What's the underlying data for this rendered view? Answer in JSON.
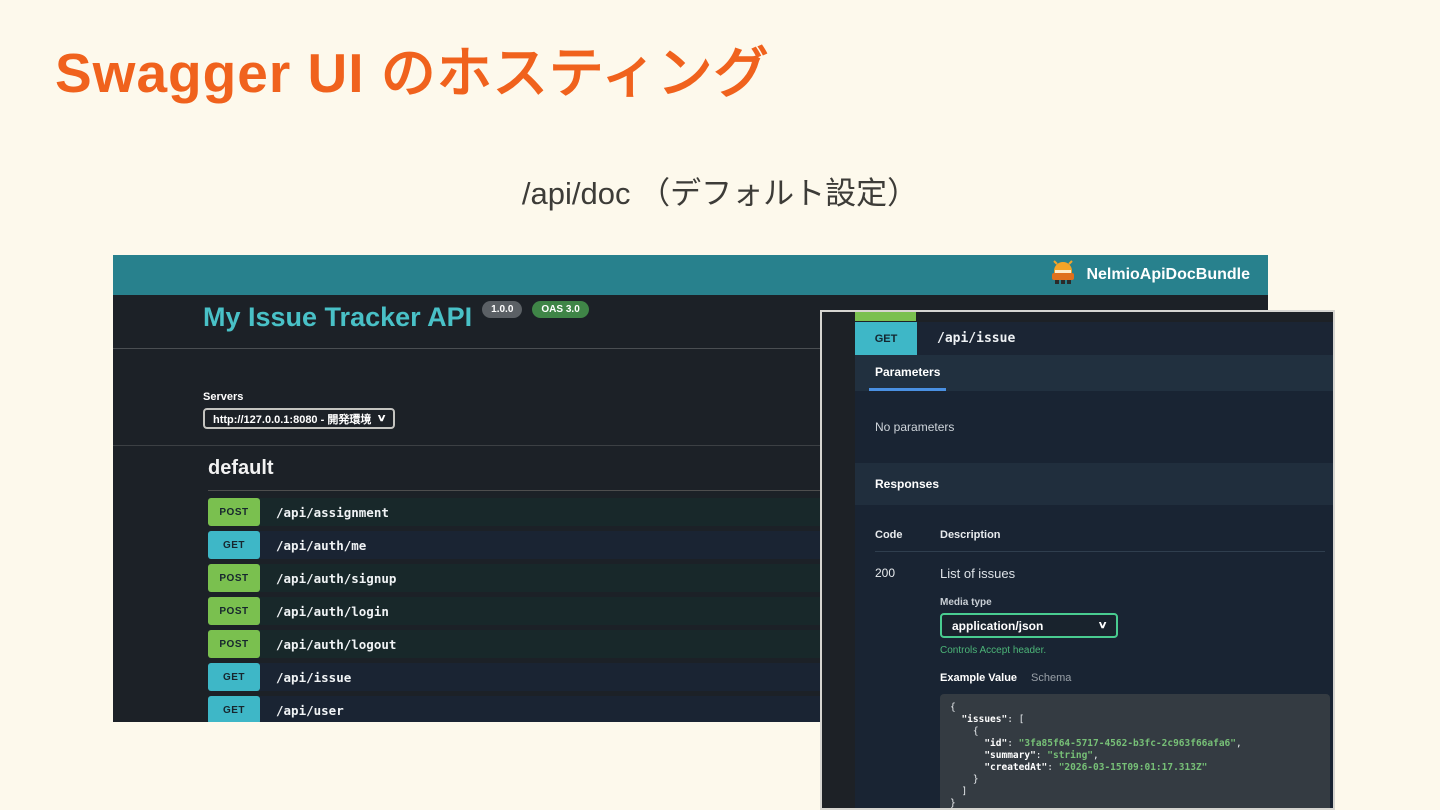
{
  "slide": {
    "title": "Swagger UI のホスティング",
    "subtitle": "/api/doc （デフォルト設定）",
    "colors": {
      "accent_orange": "#f0621d",
      "cream_bg": "#fdf9ec",
      "teal_bar": "#28818d"
    }
  },
  "methods": {
    "GET": {
      "badge": "#3eb7c7",
      "row_bg": "#1a2433"
    },
    "POST": {
      "badge": "#7ac04f",
      "row_bg": "#18282a"
    }
  },
  "main_shot": {
    "brand": {
      "name": "NelmioApiDocBundle"
    },
    "api_title": "My Issue Tracker API",
    "version_badge": "1.0.0",
    "oas_badge": "OAS 3.0",
    "servers": {
      "label": "Servers",
      "selected": "http://127.0.0.1:8080 - 開発環境"
    },
    "section": "default",
    "endpoints": [
      {
        "method": "POST",
        "path": "/api/assignment"
      },
      {
        "method": "GET",
        "path": "/api/auth/me"
      },
      {
        "method": "POST",
        "path": "/api/auth/signup"
      },
      {
        "method": "POST",
        "path": "/api/auth/login"
      },
      {
        "method": "POST",
        "path": "/api/auth/logout"
      },
      {
        "method": "GET",
        "path": "/api/issue"
      },
      {
        "method": "GET",
        "path": "/api/user"
      }
    ]
  },
  "detail_shot": {
    "method": "GET",
    "path": "/api/issue",
    "tab": "Parameters",
    "no_params": "No parameters",
    "responses_label": "Responses",
    "table": {
      "code_header": "Code",
      "desc_header": "Description"
    },
    "response": {
      "code": "200",
      "description": "List of issues",
      "media_type_label": "Media type",
      "media_type": "application/json",
      "controls_hint": "Controls Accept header.",
      "example_tab": "Example Value",
      "schema_tab": "Schema"
    },
    "code_lines": [
      [
        {
          "c": "p",
          "t": "{"
        }
      ],
      [
        {
          "c": "k",
          "t": "  \"issues\""
        },
        {
          "c": "p",
          "t": ": ["
        }
      ],
      [
        {
          "c": "p",
          "t": "    {"
        }
      ],
      [
        {
          "c": "k",
          "t": "      \"id\""
        },
        {
          "c": "p",
          "t": ": "
        },
        {
          "c": "s",
          "t": "\"3fa85f64-5717-4562-b3fc-2c963f66afa6\""
        },
        {
          "c": "p",
          "t": ","
        }
      ],
      [
        {
          "c": "k",
          "t": "      \"summary\""
        },
        {
          "c": "p",
          "t": ": "
        },
        {
          "c": "s",
          "t": "\"string\""
        },
        {
          "c": "p",
          "t": ","
        }
      ],
      [
        {
          "c": "k",
          "t": "      \"createdAt\""
        },
        {
          "c": "p",
          "t": ": "
        },
        {
          "c": "s",
          "t": "\"2026-03-15T09:01:17.313Z\""
        }
      ],
      [
        {
          "c": "p",
          "t": "    }"
        }
      ],
      [
        {
          "c": "p",
          "t": "  ]"
        }
      ],
      [
        {
          "c": "p",
          "t": "}"
        }
      ]
    ]
  }
}
